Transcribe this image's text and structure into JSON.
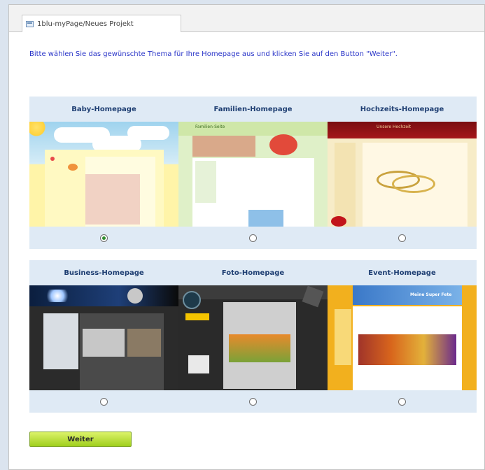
{
  "tab": {
    "label": "1blu-myPage/Neues Projekt"
  },
  "instruction": "Bitte wählen Sie das gewünschte Thema für Ihre Homepage aus und klicken Sie auf den Button \"Weiter\".",
  "themes": [
    {
      "label": "Baby-Homepage",
      "selected": true
    },
    {
      "label": "Familien-Homepage",
      "selected": false
    },
    {
      "label": "Hochzeits-Homepage",
      "selected": false
    },
    {
      "label": "Business-Homepage",
      "selected": false
    },
    {
      "label": "Foto-Homepage",
      "selected": false
    },
    {
      "label": "Event-Homepage",
      "selected": false
    }
  ],
  "thumb_text": {
    "familien_header": "Familien-Seite",
    "hochzeit_header": "Unsere Hochzeit",
    "event_header": "Meine Super Fete"
  },
  "weiter_label": "Weiter",
  "colors": {
    "accent_text": "#2a35c8",
    "label_text": "#1e3e72",
    "row_bg": "#dfeaf5",
    "button": "#b6e03a"
  }
}
